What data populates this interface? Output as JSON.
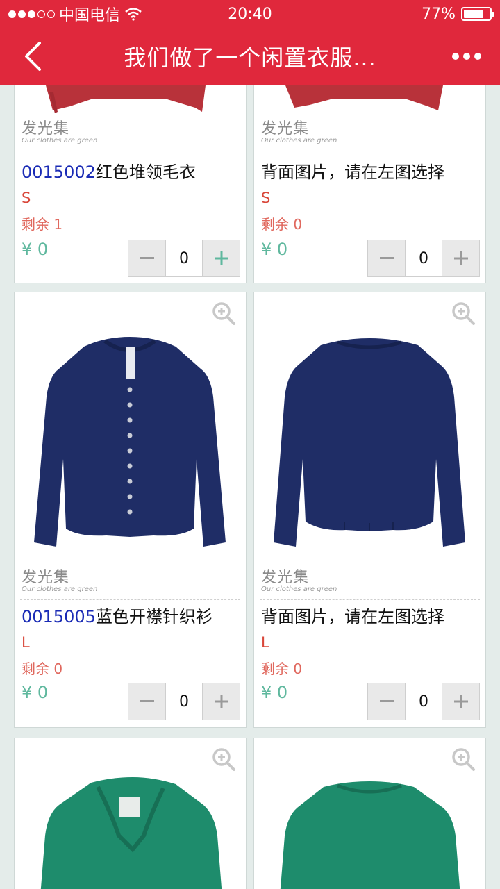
{
  "status": {
    "carrier": "中国电信",
    "time": "20:40",
    "battery": "77%",
    "battery_level": 0.77
  },
  "nav": {
    "title": "我们做了一个闲置衣服..."
  },
  "watermark": {
    "brand": "发光集",
    "tagline": "Our clothes are green"
  },
  "products": [
    {
      "code": "0015002",
      "name": "红色堆领毛衣",
      "size": "S",
      "remaining": "剩余 1",
      "price": "¥ 0",
      "qty": "0"
    },
    {
      "code": "",
      "name": "背面图片，请在左图选择",
      "size": "S",
      "remaining": "剩余 0",
      "price": "¥ 0",
      "qty": "0"
    },
    {
      "code": "0015005",
      "name": "蓝色开襟针织衫",
      "size": "L",
      "remaining": "剩余 0",
      "price": "¥ 0",
      "qty": "0"
    },
    {
      "code": "",
      "name": "背面图片，请在左图选择",
      "size": "L",
      "remaining": "剩余 0",
      "price": "¥ 0",
      "qty": "0"
    }
  ],
  "colors": {
    "brand_red": "#e0283c",
    "code_blue": "#1a2bb5",
    "price_green": "#5fb89e",
    "sweater_red": "#b8323a",
    "cardigan_navy": "#1f2d66",
    "top_green": "#1e8c6c"
  },
  "icons": [
    "back-chevron-icon",
    "more-dots-icon",
    "wifi-icon",
    "battery-icon",
    "zoom-in-icon",
    "minus-icon",
    "plus-icon"
  ]
}
